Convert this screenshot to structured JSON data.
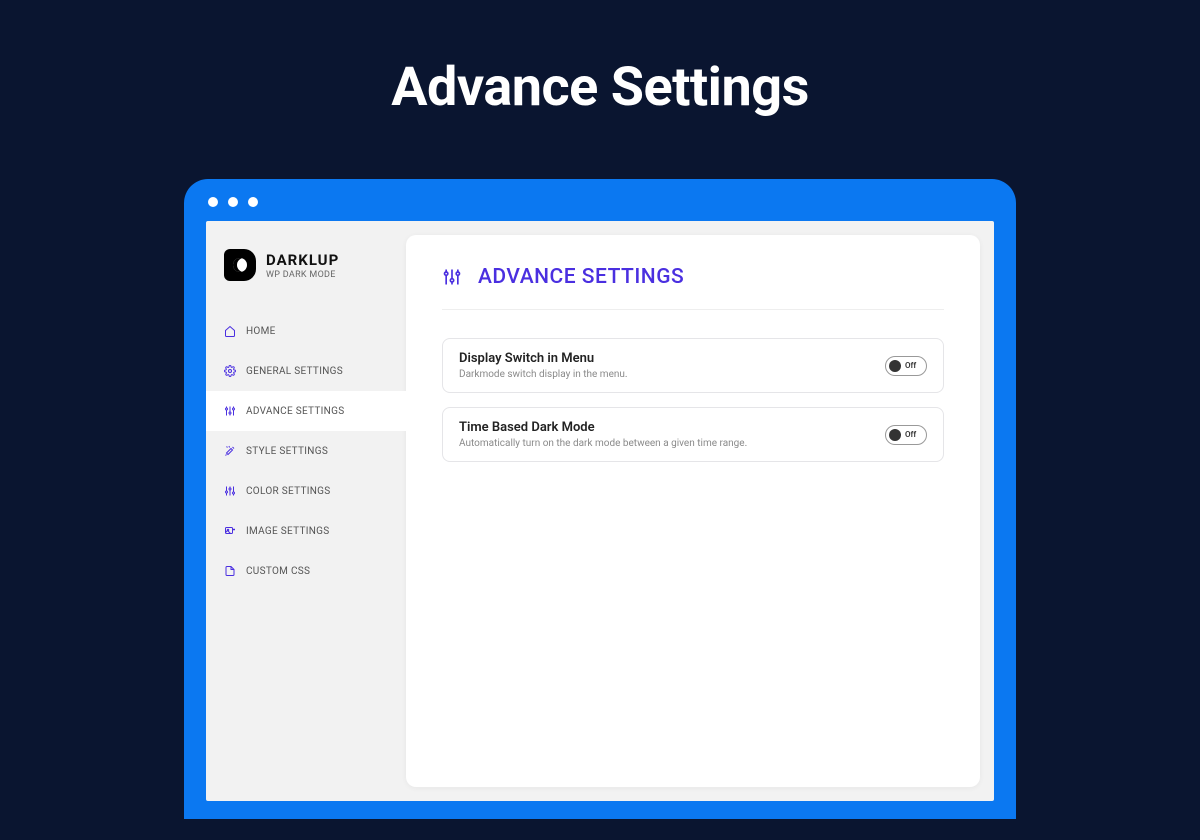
{
  "page": {
    "title": "Advance Settings"
  },
  "brand": {
    "name": "DARKLUP",
    "tagline": "WP DARK MODE"
  },
  "sidebar": {
    "items": [
      {
        "label": "HOME"
      },
      {
        "label": "GENERAL SETTINGS"
      },
      {
        "label": "ADVANCE SETTINGS"
      },
      {
        "label": "STYLE SETTINGS"
      },
      {
        "label": "COLOR SETTINGS"
      },
      {
        "label": "IMAGE SETTINGS"
      },
      {
        "label": "CUSTOM CSS"
      }
    ]
  },
  "main": {
    "title": "ADVANCE SETTINGS",
    "settings": [
      {
        "title": "Display Switch in Menu",
        "desc": "Darkmode switch display in the menu.",
        "state": "Off"
      },
      {
        "title": "Time Based Dark Mode",
        "desc": "Automatically turn on the dark mode between a given time range.",
        "state": "Off"
      }
    ]
  }
}
